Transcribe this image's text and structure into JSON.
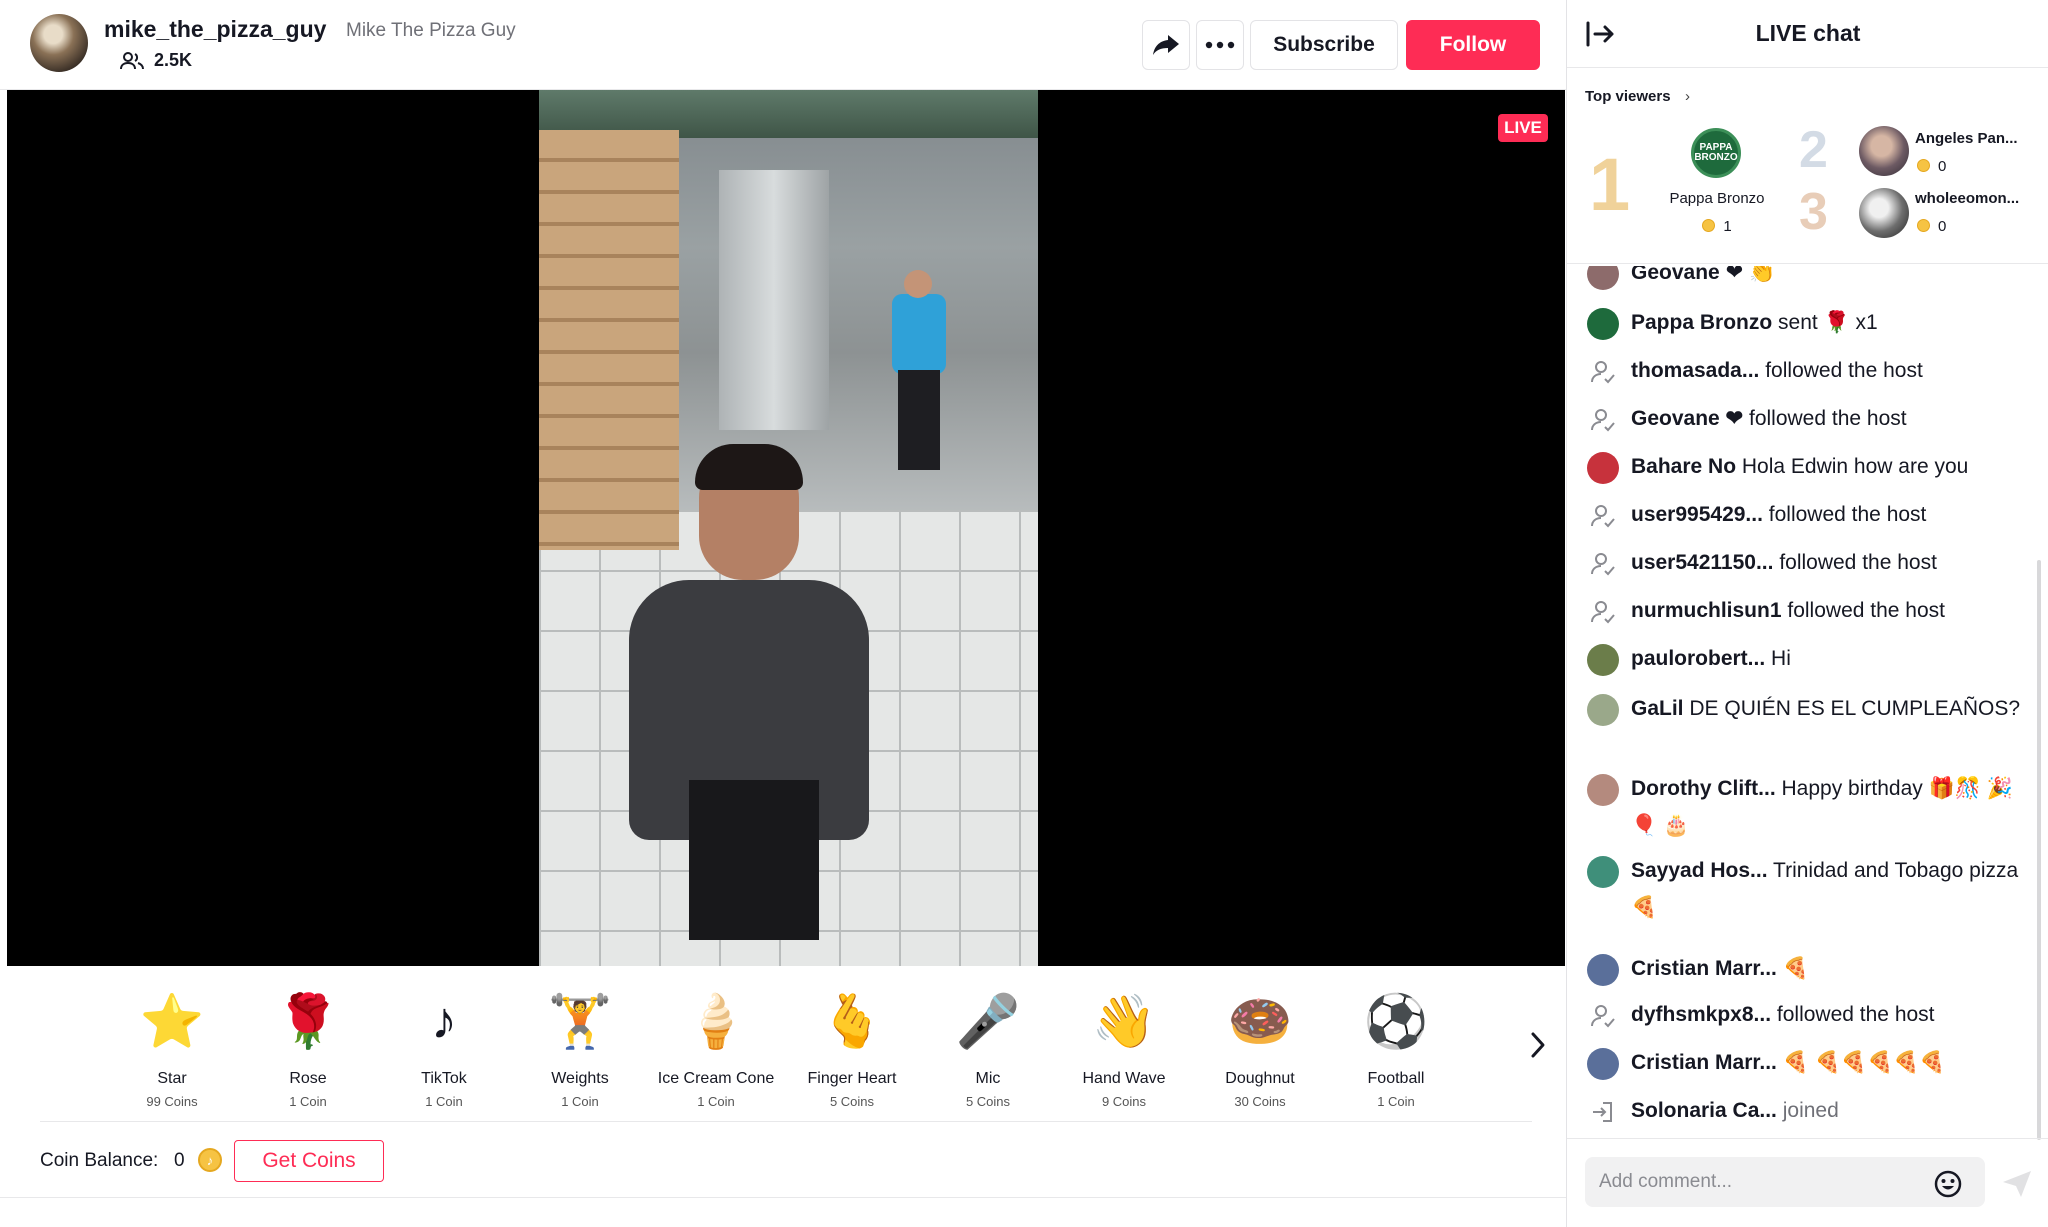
{
  "header": {
    "host_name": "mike_the_pizza_guy",
    "host_nickname": "Mike The Pizza Guy",
    "viewer_count": "2.5K",
    "subscribe_label": "Subscribe",
    "follow_label": "Follow"
  },
  "video": {
    "live_label": "LIVE"
  },
  "gifts": [
    {
      "name": "Star",
      "price": "99 Coins",
      "icon": "⭐"
    },
    {
      "name": "Rose",
      "price": "1 Coin",
      "icon": "🌹"
    },
    {
      "name": "TikTok",
      "price": "1 Coin",
      "icon": "♪"
    },
    {
      "name": "Weights",
      "price": "1 Coin",
      "icon": "🏋"
    },
    {
      "name": "Ice Cream Cone",
      "price": "1 Coin",
      "icon": "🍦"
    },
    {
      "name": "Finger Heart",
      "price": "5 Coins",
      "icon": "🫰"
    },
    {
      "name": "Mic",
      "price": "5 Coins",
      "icon": "🎤"
    },
    {
      "name": "Hand Wave",
      "price": "9 Coins",
      "icon": "👋"
    },
    {
      "name": "Doughnut",
      "price": "30 Coins",
      "icon": "🍩"
    },
    {
      "name": "Football",
      "price": "1 Coin",
      "icon": "⚽"
    }
  ],
  "coins": {
    "balance_label": "Coin Balance:",
    "balance_value": "0",
    "get_coins_label": "Get Coins"
  },
  "chat": {
    "title": "LIVE chat",
    "top_viewers_label": "Top viewers",
    "top_viewers": [
      {
        "rank": "1",
        "name": "Pappa Bronzo",
        "score": "1",
        "avatar_text": "PAPPA BRONZO"
      },
      {
        "rank": "2",
        "name": "Angeles Pan...",
        "score": "0"
      },
      {
        "rank": "3",
        "name": "wholeeomon...",
        "score": "0"
      }
    ],
    "messages": [
      {
        "user": "Geovane",
        "text": "❤ 👏",
        "kind": "comment",
        "avatar_color": "#8d6b6b"
      },
      {
        "user": "Pappa Bronzo",
        "text": "sent 🌹 x1",
        "kind": "gift",
        "avatar_color": "#1e6a3c"
      },
      {
        "user": "thomasada...",
        "text": "followed the host",
        "kind": "follow"
      },
      {
        "user": "Geovane ❤",
        "text": "followed the host",
        "kind": "follow"
      },
      {
        "user": "Bahare No",
        "text": "Hola Edwin how are you",
        "kind": "comment",
        "avatar_color": "#c7323c"
      },
      {
        "user": "user995429...",
        "text": "followed the host",
        "kind": "follow"
      },
      {
        "user": "user5421150...",
        "text": "followed the host",
        "kind": "follow"
      },
      {
        "user": "nurmuchlisun1",
        "text": "followed the host",
        "kind": "follow"
      },
      {
        "user": "paulorobert...",
        "text": "Hi",
        "kind": "comment",
        "avatar_color": "#6b7d4a"
      },
      {
        "user": "GaLil",
        "text": "DE QUIÉN ES EL CUMPLEAÑOS?",
        "kind": "comment",
        "avatar_color": "#9aa88a"
      },
      {
        "user": "Dorothy Clift...",
        "text": "Happy birthday 🎁🎊 🎉🎈 🎂",
        "kind": "comment",
        "avatar_color": "#b48a7e"
      },
      {
        "user": "Sayyad Hos...",
        "text": "Trinidad and Tobago pizza 🍕",
        "kind": "comment",
        "avatar_color": "#3f8f7a"
      },
      {
        "user": "Cristian Marr...",
        "text": "🍕",
        "kind": "comment",
        "avatar_color": "#5a6f9a"
      },
      {
        "user": "dyfhsmkpx8...",
        "text": "followed the host",
        "kind": "follow"
      },
      {
        "user": "Cristian Marr...",
        "text": "🍕 🍕🍕🍕🍕🍕",
        "kind": "comment",
        "avatar_color": "#5a6f9a"
      },
      {
        "user": "Solonaria Ca...",
        "text": "joined",
        "kind": "join"
      }
    ],
    "input_placeholder": "Add comment..."
  }
}
